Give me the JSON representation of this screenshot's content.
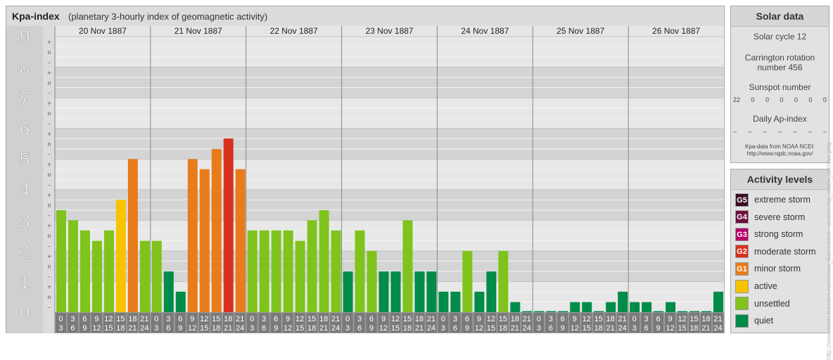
{
  "kpa_panel": {
    "title": "Kpa-index",
    "subtitle": "(planetary 3-hourly index of geomagnetic activity)"
  },
  "colors": {
    "quiet": "#008c48",
    "unsettled": "#7fc31c",
    "active": "#f8c300",
    "G1": "#e87b1a",
    "G2": "#d8301f",
    "G3": "#b7006a",
    "G4": "#6e0e3e",
    "G5": "#3a0a22"
  },
  "chart_data": {
    "type": "bar",
    "ylim": [
      0,
      9
    ],
    "y_ticks": [
      "0",
      "1",
      "2",
      "3",
      "4",
      "5",
      "6",
      "7",
      "8",
      "9"
    ],
    "sub_ticks": [
      "–",
      "o",
      "+"
    ],
    "days": [
      "20 Nov 1887",
      "21 Nov 1887",
      "22 Nov 1887",
      "23 Nov 1887",
      "24 Nov 1887",
      "25 Nov 1887",
      "26 Nov 1887"
    ],
    "hour_labels_top": [
      "0",
      "3",
      "6",
      "9",
      "12",
      "15",
      "18",
      "21"
    ],
    "hour_labels_bottom": [
      "3",
      "6",
      "9",
      "12",
      "15",
      "18",
      "21",
      "24"
    ],
    "values": [
      [
        3.33,
        3.0,
        2.67,
        2.33,
        2.67,
        3.67,
        5.0,
        2.33
      ],
      [
        2.33,
        1.33,
        0.67,
        5.0,
        4.67,
        5.33,
        5.67,
        4.67
      ],
      [
        2.67,
        2.67,
        2.67,
        2.67,
        2.33,
        3.0,
        3.33,
        2.67
      ],
      [
        1.33,
        2.67,
        2.0,
        1.33,
        1.33,
        3.0,
        1.33,
        1.33
      ],
      [
        0.67,
        0.67,
        2.0,
        0.67,
        1.33,
        2.0,
        0.33,
        0.0
      ],
      [
        0.0,
        0.0,
        0.0,
        0.33,
        0.33,
        0.0,
        0.33,
        0.67
      ],
      [
        0.33,
        0.33,
        0.0,
        0.33,
        0.0,
        0.0,
        0.0,
        0.67
      ]
    ],
    "levels": [
      [
        1,
        1,
        1,
        1,
        1,
        2,
        3,
        1
      ],
      [
        1,
        0,
        0,
        3,
        3,
        3,
        4,
        3
      ],
      [
        1,
        1,
        1,
        1,
        1,
        1,
        1,
        1
      ],
      [
        0,
        1,
        1,
        0,
        0,
        1,
        0,
        0
      ],
      [
        0,
        0,
        1,
        0,
        0,
        1,
        0,
        0
      ],
      [
        0,
        0,
        0,
        0,
        0,
        0,
        0,
        0
      ],
      [
        0,
        0,
        0,
        0,
        0,
        0,
        0,
        0
      ]
    ],
    "level_keys": [
      "quiet",
      "unsettled",
      "active",
      "G1",
      "G2"
    ]
  },
  "solar": {
    "title": "Solar data",
    "cycle": "Solar cycle 12",
    "carrington_line1": "Carrington rotation",
    "carrington_line2": "number 456",
    "sunspot_title": "Sunspot number",
    "sunspots": [
      "22",
      "0",
      "0",
      "0",
      "0",
      "0",
      "0"
    ],
    "ap_title": "Daily Ap-index",
    "ap_values": [
      "–",
      "–",
      "–",
      "–",
      "–",
      "–",
      "–"
    ],
    "source_line1": "Kpa-data from NOAA NCEI:",
    "source_line2": "http://www.ngdc.noaa.gov/"
  },
  "activity": {
    "title": "Activity levels",
    "items": [
      {
        "badge": "G5",
        "label": "extreme storm",
        "color": "#3a0a22"
      },
      {
        "badge": "G4",
        "label": "severe storm",
        "color": "#6e0e3e"
      },
      {
        "badge": "G3",
        "label": "strong storm",
        "color": "#b7006a"
      },
      {
        "badge": "G2",
        "label": "moderate storm",
        "color": "#d8301f"
      },
      {
        "badge": "G1",
        "label": "minor storm",
        "color": "#e87b1a"
      },
      {
        "badge": "",
        "label": "active",
        "color": "#f8c300"
      },
      {
        "badge": "",
        "label": "unsettled",
        "color": "#7fc31c"
      },
      {
        "badge": "",
        "label": "quiet",
        "color": "#008c48"
      }
    ]
  },
  "watermark": "http://www.tesis.lebedev.ru/en/sun_flares.html - archive/kp_index_archive.png"
}
